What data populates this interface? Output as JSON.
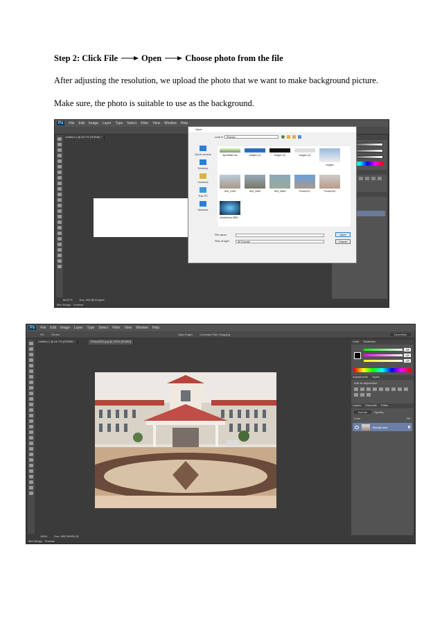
{
  "step": {
    "prefix": "Step 2: Click File",
    "open": "Open",
    "choose": "Choose photo from the file"
  },
  "paragraph1": "After adjusting the resolution, we upload the photo that we want to make background picture.",
  "paragraph2": "Make sure, the photo is suitable to use as the background.",
  "shot1": {
    "logo": "Ps",
    "menu": [
      "File",
      "Edit",
      "Image",
      "Layer",
      "Type",
      "Select",
      "Filter",
      "View",
      "Window",
      "Help"
    ],
    "doc_tab": "Untitled-1 @ 66.7% (RGB/8) *",
    "zoom": "66.67%",
    "doc_info": "Doc: 993.8K/0 bytes",
    "tabs": [
      "Mini Bridge",
      "Timeline"
    ],
    "dialog": {
      "title": "Open",
      "look_in_label": "Look in:",
      "look_in_value": "Pictures",
      "nav": [
        "Quick access",
        "Desktop",
        "Libraries",
        "This PC",
        "Network"
      ],
      "thumbs": [
        "ajsvdfdsfc.dsi",
        "images (1)",
        "images (2)",
        "images (4)",
        "images",
        "IMG_2435",
        "IMG_5559",
        "IMG_5856",
        "Photo0217",
        "Photo0251",
        "photokuiny-0851..."
      ],
      "file_name_label": "File name:",
      "file_name_value": "",
      "files_of_type_label": "Files of type:",
      "files_of_type_value": "All Formats",
      "open_button": "Open",
      "cancel_button": "Cancel"
    }
  },
  "shot2": {
    "logo": "Ps",
    "menu": [
      "File",
      "Edit",
      "Image",
      "Layer",
      "Type",
      "Select",
      "Filter",
      "View",
      "Window",
      "Help"
    ],
    "options": [
      "Fill:",
      "Stroke:",
      "Align Edges",
      "Constrain Path Dragging"
    ],
    "workspace": "Essentials",
    "doc_tab1": "Untitled-1 @ 66.7% (RGB/8) *",
    "doc_tab2": "Photo0251.jpg @ 100% (RGB/8)",
    "zoom": "100%",
    "doc_info": "Doc: 900.2K/900.2K",
    "tabs": [
      "Mini Bridge",
      "Timeline"
    ],
    "panel_color": [
      "Color",
      "Swatches"
    ],
    "color_values": [
      "240",
      "240",
      "240"
    ],
    "panel_adjust": [
      "Adjustments",
      "Styles"
    ],
    "add_adjustment": "Add an adjustment",
    "panel_layers": [
      "Layers",
      "Channels",
      "Paths"
    ],
    "layer_kind": "Normal",
    "opacity_label": "Opacity:",
    "fill_label": "Fill:",
    "lock_label": "Lock:",
    "layer_name": "Background"
  }
}
